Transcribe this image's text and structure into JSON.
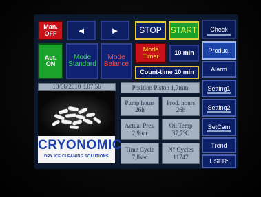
{
  "mode_buttons": {
    "manual": [
      "Man.",
      "OFF"
    ],
    "auto": [
      "Aut.",
      "ON"
    ],
    "standard": [
      "Mode",
      "Standard"
    ],
    "balance": [
      "Mode",
      "Balance"
    ],
    "timer": [
      "Mode",
      "Timer"
    ],
    "timer_value": "10 min",
    "count_time": "Count-time 10 min"
  },
  "nav": {
    "prev_icon": "◄",
    "next_icon": "►"
  },
  "controls": {
    "stop": "STOP",
    "start": "START"
  },
  "sidebar": {
    "items": [
      {
        "label": "Check"
      },
      {
        "label": "Produc."
      },
      {
        "label": "Alarm"
      },
      {
        "label": "Setting1"
      },
      {
        "label": "Setting2"
      },
      {
        "label": "SetCam"
      },
      {
        "label": "Trend"
      },
      {
        "label": "USER:"
      }
    ]
  },
  "status": {
    "datetime": "10/06/2010 8.07.56",
    "position_piston": "Position Piston 1,7mm"
  },
  "readings": [
    {
      "label": "Pump hours",
      "value": "26h"
    },
    {
      "label": "Prod. hours",
      "value": "26h"
    },
    {
      "label": "Actual Pres.",
      "value": "2,9bar"
    },
    {
      "label": "Oil Temp",
      "value": "37,7°C"
    },
    {
      "label": "Time Cycle",
      "value": "7,8sec"
    },
    {
      "label": "N° Cycles",
      "value": "11747"
    }
  ],
  "logo": {
    "wordmark": "CRYONOMIC",
    "tagline": "DRY ICE CLEANING SOLUTIONS"
  }
}
